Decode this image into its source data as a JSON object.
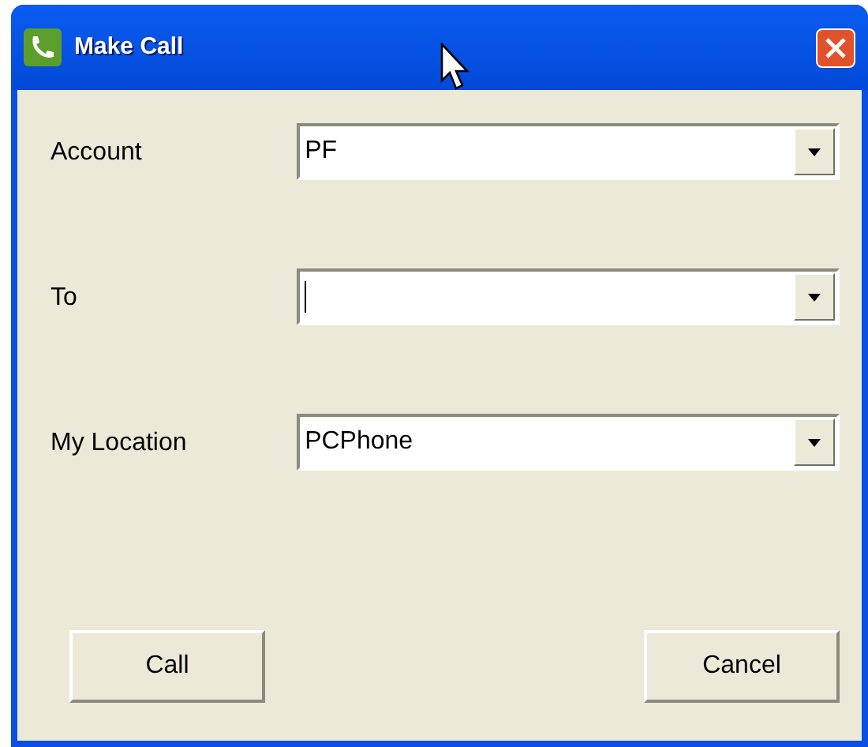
{
  "window": {
    "title": "Make Call"
  },
  "fields": [
    {
      "label": "Account",
      "value": "PF",
      "focused": false
    },
    {
      "label": "To",
      "focused": true
    },
    {
      "label": "My Location",
      "value": "PCPhone",
      "focused": false
    }
  ],
  "buttons": [
    "Call",
    "Cancel"
  ]
}
